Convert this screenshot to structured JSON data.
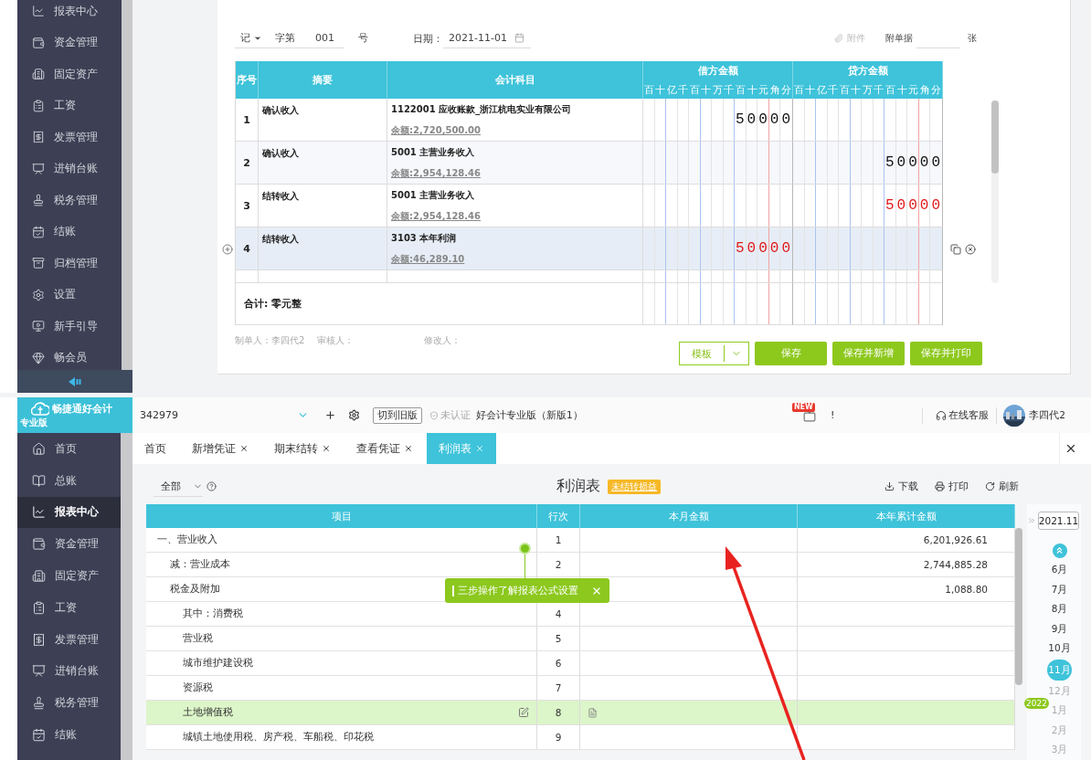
{
  "voucher_page": {
    "sidebar": {
      "items": [
        {
          "label": "报表中心"
        },
        {
          "label": "资金管理"
        },
        {
          "label": "固定资产"
        },
        {
          "label": "工资"
        },
        {
          "label": "发票管理"
        },
        {
          "label": "进销台账"
        },
        {
          "label": "税务管理"
        },
        {
          "label": "结账"
        },
        {
          "label": "归档管理"
        },
        {
          "label": "设置"
        },
        {
          "label": "新手引导"
        },
        {
          "label": "畅会员"
        }
      ]
    },
    "voucher": {
      "type": "记",
      "word": "字第",
      "number": "001",
      "number_unit": "号",
      "date_label": "日期：",
      "date": "2021-11-01",
      "attachment": "附件",
      "attached_label": "附单据",
      "attached_unit": "张",
      "columns": [
        {
          "label": "序号"
        },
        {
          "label": "摘要"
        },
        {
          "label": "会计科目"
        },
        {
          "label": "借方金额"
        },
        {
          "label": "贷方金额"
        }
      ],
      "debit_units": [
        "百",
        "十",
        "亿",
        "千",
        "百",
        "十",
        "万",
        "千",
        "百",
        "十",
        "元",
        "角",
        "分"
      ],
      "credit_units": [
        "百",
        "十",
        "亿",
        "千",
        "百",
        "十",
        "万",
        "千",
        "百",
        "十",
        "元",
        "角",
        "分"
      ],
      "entries": [
        {
          "index": "1",
          "summary": "确认收入",
          "account": "1122001 应收账款_浙江杭电实业有限公司",
          "balance": "余额:2,720,500.00",
          "debit": "50000",
          "red": false,
          "hovered": false
        },
        {
          "index": "2",
          "summary": "确认收入",
          "account": "5001 主营业务收入",
          "balance": "余额:2,954,128.46",
          "credit": "50000",
          "red": false,
          "hovered": false
        },
        {
          "index": "3",
          "summary": "结转收入",
          "account": "5001 主营业务收入",
          "balance": "余额:2,954,128.46",
          "credit": "50000",
          "red": true,
          "hovered": false
        },
        {
          "index": "4",
          "summary": "结转收入",
          "account": "3103 本年利润",
          "balance": "余额:46,289.10",
          "debit": "50000",
          "red": true,
          "hovered": true
        }
      ],
      "total": "合计:  零元整",
      "signatures": [
        "制单人：李四代2",
        "审核人：",
        "修改人："
      ],
      "template_button": "模板",
      "buttons": [
        "保存",
        "保存并新增",
        "保存并打印"
      ]
    }
  },
  "report_page": {
    "brand": {
      "name": "畅捷通好会计",
      "edition": "专业版"
    },
    "account_id": "342979",
    "switch_button": "切到旧版",
    "cert_status": "未认证",
    "product": "好会计专业版（新版1）",
    "new_badge": "NEW",
    "notice": "!",
    "support": "在线客服",
    "user": "李四代2",
    "sidebar": {
      "items": [
        {
          "label": "首页",
          "selected": false
        },
        {
          "label": "总账",
          "selected": false
        },
        {
          "label": "报表中心",
          "selected": true
        },
        {
          "label": "资金管理",
          "selected": false
        },
        {
          "label": "固定资产",
          "selected": false
        },
        {
          "label": "工资",
          "selected": false
        },
        {
          "label": "发票管理",
          "selected": false
        },
        {
          "label": "进销台账",
          "selected": false
        },
        {
          "label": "税务管理",
          "selected": false
        },
        {
          "label": "结账",
          "selected": false
        }
      ]
    },
    "tabs": [
      {
        "label": "首页",
        "closable": false,
        "selected": false
      },
      {
        "label": "新增凭证",
        "closable": true,
        "selected": false
      },
      {
        "label": "期末结转",
        "closable": true,
        "selected": false
      },
      {
        "label": "查看凭证",
        "closable": true,
        "selected": false
      },
      {
        "label": "利润表",
        "closable": true,
        "selected": true
      }
    ],
    "filter": "全部",
    "title": "利润表",
    "status_badge": "未结转损益",
    "actions": [
      "下载",
      "打印",
      "刷新"
    ],
    "table": {
      "columns": [
        "项目",
        "行次",
        "本月金额",
        "本年累计金额"
      ],
      "rows": [
        {
          "item": "一、营业收入",
          "line": "1",
          "year": "6,201,926.61",
          "highlighted": false,
          "children": [
            {
              "item": "减：营业成本",
              "line": "2",
              "year": "2,744,885.28",
              "highlighted": false
            },
            {
              "item": "税金及附加",
              "year": "1,088.80",
              "highlighted": false,
              "children": [
                {
                  "item": "其中：消费税",
                  "line": "4",
                  "highlighted": false
                },
                {
                  "item": "营业税",
                  "line": "5",
                  "highlighted": false
                },
                {
                  "item": "城市维护建设税",
                  "line": "6",
                  "highlighted": false
                },
                {
                  "item": "资源税",
                  "line": "7",
                  "highlighted": false
                },
                {
                  "item": "土地增值税",
                  "line": "8",
                  "highlighted": true
                },
                {
                  "item": "城镇土地使用税、房产税、车船税、印花税",
                  "line": "9",
                  "highlighted": false
                }
              ]
            }
          ]
        }
      ]
    },
    "tooltip": "三步操作了解报表公式设置",
    "period": "2021.11",
    "months": [
      {
        "label": "6月",
        "selected": false,
        "disabled": false
      },
      {
        "label": "7月",
        "selected": false,
        "disabled": false
      },
      {
        "label": "8月",
        "selected": false,
        "disabled": false
      },
      {
        "label": "9月",
        "selected": false,
        "disabled": false
      },
      {
        "label": "10月",
        "selected": false,
        "disabled": false
      },
      {
        "label": "11月",
        "selected": true,
        "disabled": false
      },
      {
        "label": "12月",
        "selected": false,
        "disabled": true
      },
      {
        "label": "1月",
        "selected": false,
        "disabled": true
      },
      {
        "label": "2月",
        "selected": false,
        "disabled": true
      },
      {
        "label": "3月",
        "selected": false,
        "disabled": true
      }
    ],
    "year_badge": "2022"
  }
}
